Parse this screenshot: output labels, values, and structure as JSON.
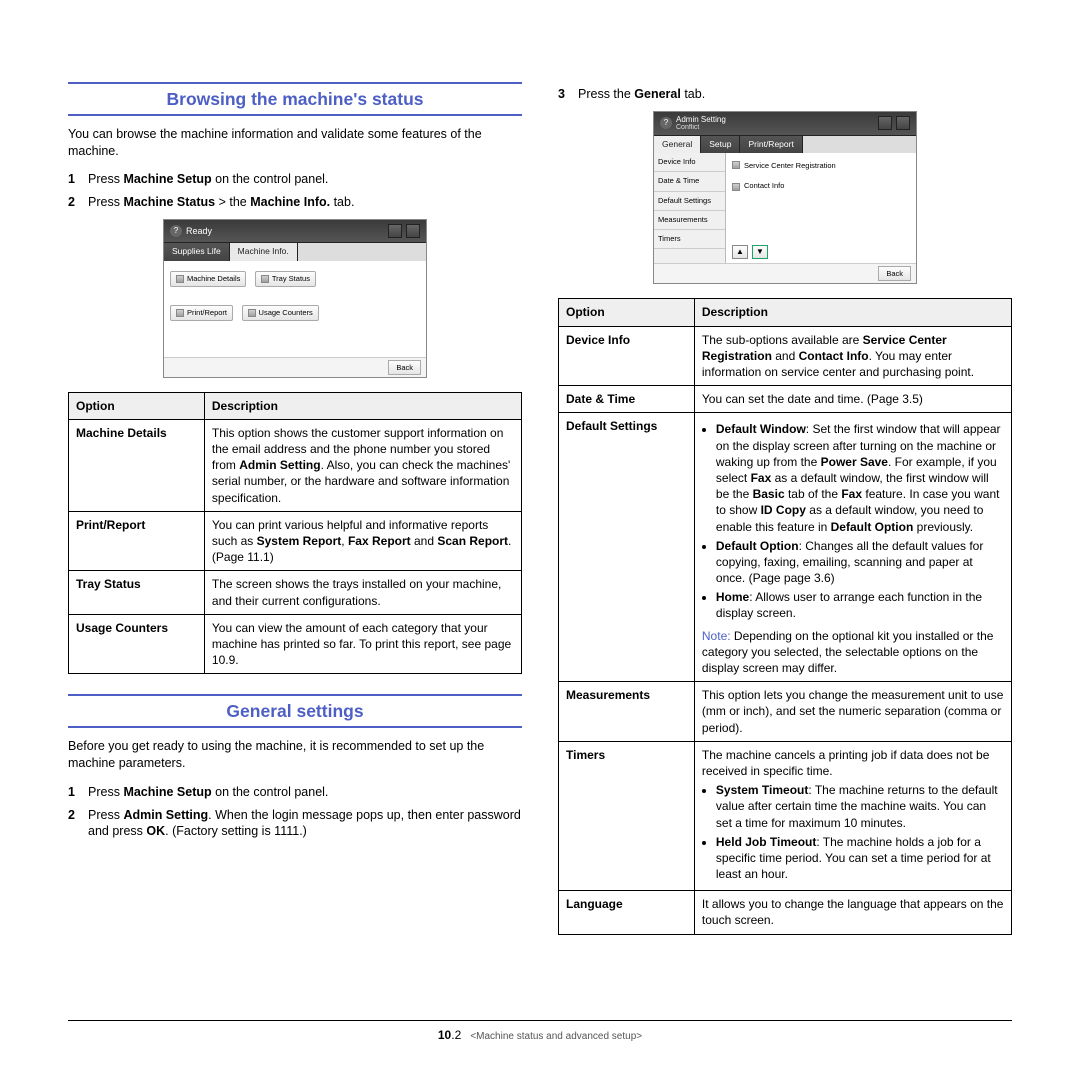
{
  "sections": {
    "browsing": {
      "title": "Browsing the machine's status",
      "intro": "You can browse the machine information and validate some features of the machine.",
      "steps": [
        {
          "num": "1",
          "pre": "Press ",
          "b1": "Machine Setup",
          "post": " on the control panel."
        },
        {
          "num": "2",
          "pre": "Press ",
          "b1": "Machine Status",
          "mid": " > the ",
          "b2": "Machine Info.",
          "post": " tab."
        }
      ]
    },
    "general": {
      "title": "General settings",
      "intro": "Before you get ready to using the machine, it is recommended to set up the machine parameters.",
      "steps": [
        {
          "num": "1",
          "pre": "Press ",
          "b1": "Machine Setup",
          "post": " on the control panel."
        },
        {
          "num": "2",
          "pre": "Press ",
          "b1": "Admin Setting",
          "mid1": ". When the login message pops up, then enter password and press ",
          "b2": "OK",
          "post": ". (Factory setting is 1111.)"
        }
      ],
      "step3": {
        "num": "3",
        "pre": "Press the ",
        "b1": "General",
        "post": " tab."
      }
    }
  },
  "shot1": {
    "bar": "Ready",
    "tabs": {
      "t1": "Supplies Life",
      "t2": "Machine Info."
    },
    "btns": {
      "b1": "Machine Details",
      "b2": "Tray Status",
      "b3": "Print/Report",
      "b4": "Usage Counters"
    },
    "back": "Back"
  },
  "shot2": {
    "bar1": "Admin Setting",
    "bar2": "Conflict",
    "tabs": {
      "t1": "General",
      "t2": "Setup",
      "t3": "Print/Report"
    },
    "nav": {
      "n1": "Device Info",
      "n2": "Date & Time",
      "n3": "Default Settings",
      "n4": "Measurements",
      "n5": "Timers"
    },
    "links": {
      "l1": "Service Center Registration",
      "l2": "Contact Info"
    },
    "back": "Back"
  },
  "table1": {
    "headers": {
      "h1": "Option",
      "h2": "Description"
    },
    "rows": {
      "r1": {
        "opt": "Machine Details",
        "d1": "This option shows the customer support information on the email address and the phone number you stored from ",
        "b1": "Admin Setting",
        "d2": ". Also, you can check the machines' serial number, or the hardware and software information specification."
      },
      "r2": {
        "opt": "Print/Report",
        "d1": "You can print various helpful and informative reports such as ",
        "b1": "System Report",
        "d2": ", ",
        "b2": "Fax Report",
        "d3": " and ",
        "b3": "Scan Report",
        "d4": ". (Page 11.1)"
      },
      "r3": {
        "opt": "Tray Status",
        "d": "The screen shows the trays installed on your machine, and their current configurations."
      },
      "r4": {
        "opt": "Usage Counters",
        "d": "You can view the amount of each category that your machine has printed so far. To print this report, see page 10.9."
      }
    }
  },
  "table2": {
    "headers": {
      "h1": "Option",
      "h2": "Description"
    },
    "rows": {
      "r1": {
        "opt": "Device Info",
        "d1": "The sub-options available are ",
        "b1": "Service Center Registration",
        "d2": " and ",
        "b2": "Contact Info",
        "d3": ". You may enter information on service center and purchasing point."
      },
      "r2": {
        "opt": "Date & Time",
        "d": "You can set the date and time. (Page 3.5)"
      },
      "r3": {
        "opt": "Default Settings",
        "bul1": {
          "b1": "Default Window",
          "t1": ": Set the first window that will appear on the display screen after turning on the machine or waking up from the ",
          "b2": "Power Save",
          "t2": ". For example, if you select ",
          "b3": "Fax",
          "t3": " as a default window, the first window will be the ",
          "b4": "Basic",
          "t4": " tab of the ",
          "b5": "Fax",
          "t5": " feature. In case you want to show ",
          "b6": "ID Copy",
          "t6": " as a default window, you need to enable this feature in ",
          "b7": "Default Option",
          "t7": " previously."
        },
        "bul2": {
          "b1": "Default Option",
          "t1": ": Changes all the default values for copying, faxing, emailing, scanning and paper at once. (Page  page 3.6)"
        },
        "bul3": {
          "b1": "Home",
          "t1": ":  Allows user to arrange each function in the display screen."
        },
        "note": {
          "label": "Note:",
          "t": " Depending on the optional kit you installed or the category you selected, the selectable options on the display screen may differ."
        }
      },
      "r4": {
        "opt": "Measurements",
        "d": "This option lets you change the measurement unit to use (mm or inch), and set the numeric separation (comma or period)."
      },
      "r5": {
        "opt": "Timers",
        "d": "The machine cancels a printing job if data does not be received in specific time.",
        "bul1": {
          "b1": "System Timeout",
          "t1": ": The machine returns to the default value after certain time the machine waits. You can set a time for maximum 10 minutes."
        },
        "bul2": {
          "b1": "Held Job Timeout",
          "t1": ": The machine holds a job for a specific time period. You can set a time period for at least an hour."
        }
      },
      "r6": {
        "opt": "Language",
        "d": "It allows you to change the language that appears on the touch screen."
      }
    }
  },
  "footer": {
    "pageBold": "10",
    "pageLight": ".2",
    "crumb": "<Machine status and advanced setup>"
  }
}
